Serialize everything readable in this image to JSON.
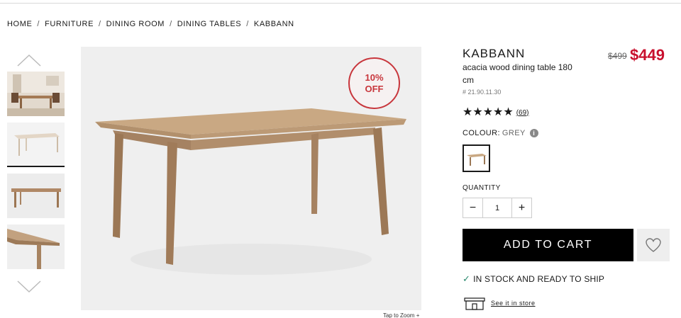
{
  "breadcrumb": {
    "items": [
      "HOME",
      "FURNITURE",
      "DINING ROOM",
      "DINING TABLES",
      "KABBANN"
    ],
    "separator": "/"
  },
  "gallery": {
    "badge_line1": "10%",
    "badge_line2": "OFF",
    "zoom_label": "Tap to Zoom +"
  },
  "product": {
    "title": "KABBANN",
    "subtitle": "acacia wood dining table 180 cm",
    "sku": "# 21.90.11.30",
    "price_old": "$499",
    "price_new": "$449",
    "stars": "★★★★★",
    "rating": 5,
    "review_count": "(69)",
    "colour_label": "COLOUR:",
    "colour_value": "GREY",
    "quantity_label": "QUANTITY",
    "quantity_value": "1",
    "minus": "−",
    "plus": "+",
    "add_to_cart": "ADD TO CART",
    "stock_status": "IN STOCK AND READY TO SHIP",
    "store_link": "See it in store"
  },
  "colors": {
    "sale": "#c8102e",
    "stock_check": "#2a8a6e",
    "cart_button": "#000000"
  }
}
